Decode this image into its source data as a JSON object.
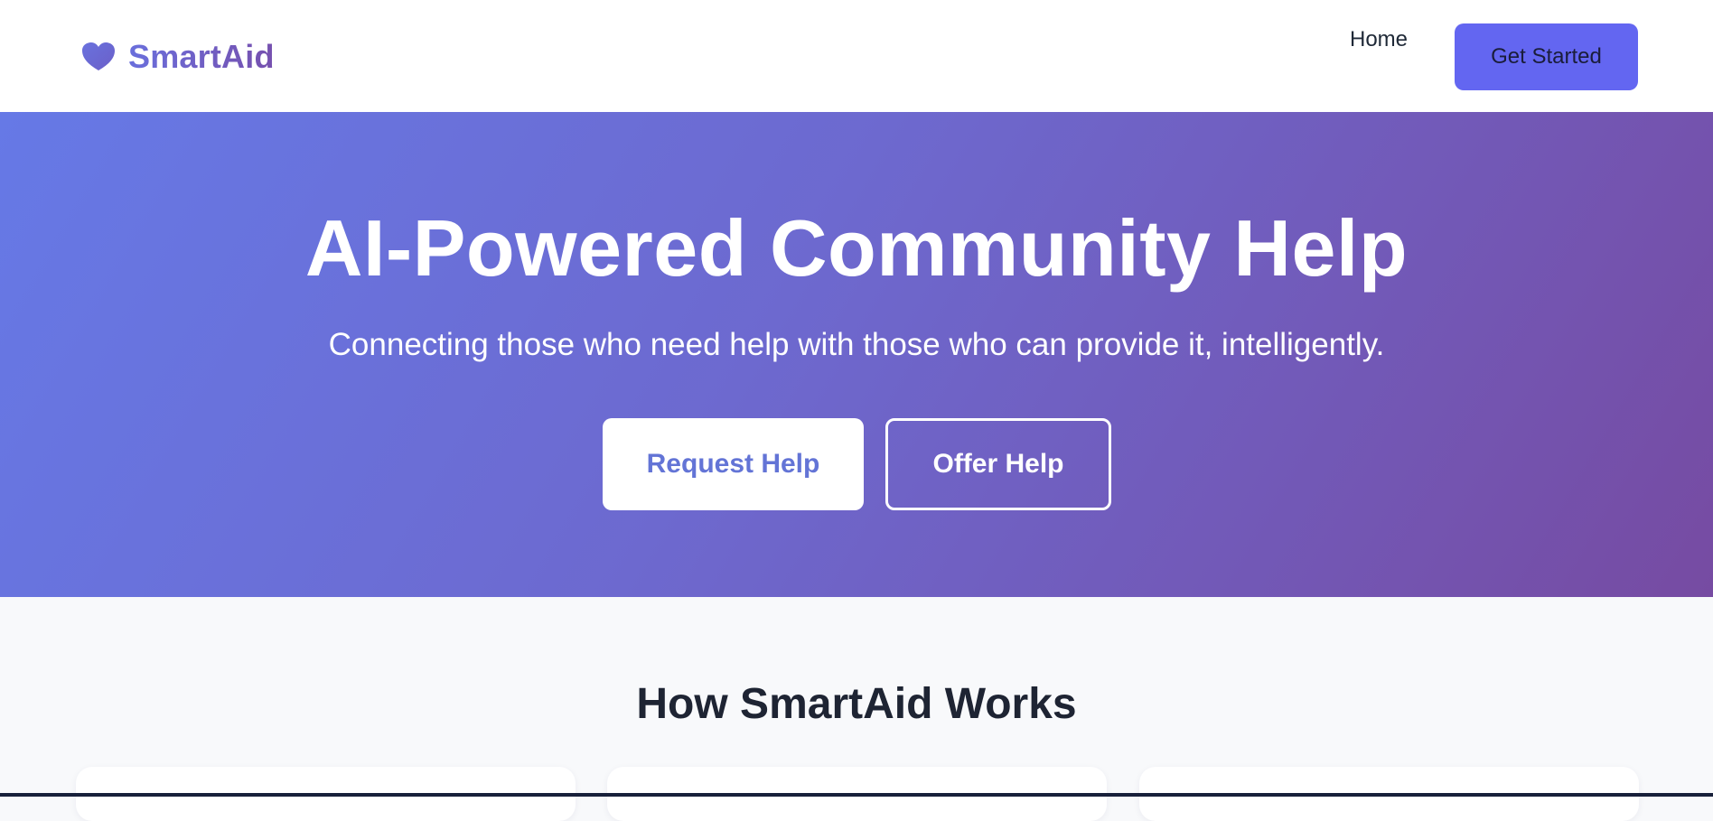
{
  "brand": {
    "name": "SmartAid",
    "icon": "heart-icon"
  },
  "nav": {
    "home_label": "Home",
    "cta_label": "Get Started"
  },
  "hero": {
    "title": "AI-Powered Community Help",
    "subtitle": "Connecting those who need help with those who can provide it, intelligently.",
    "primary_button": "Request Help",
    "secondary_button": "Offer Help"
  },
  "how_it_works": {
    "title": "How SmartAid Works"
  },
  "colors": {
    "accent": "#6366f1",
    "gradient_start": "#667eea",
    "gradient_end": "#764ba2",
    "heading_dark": "#1e2433"
  }
}
